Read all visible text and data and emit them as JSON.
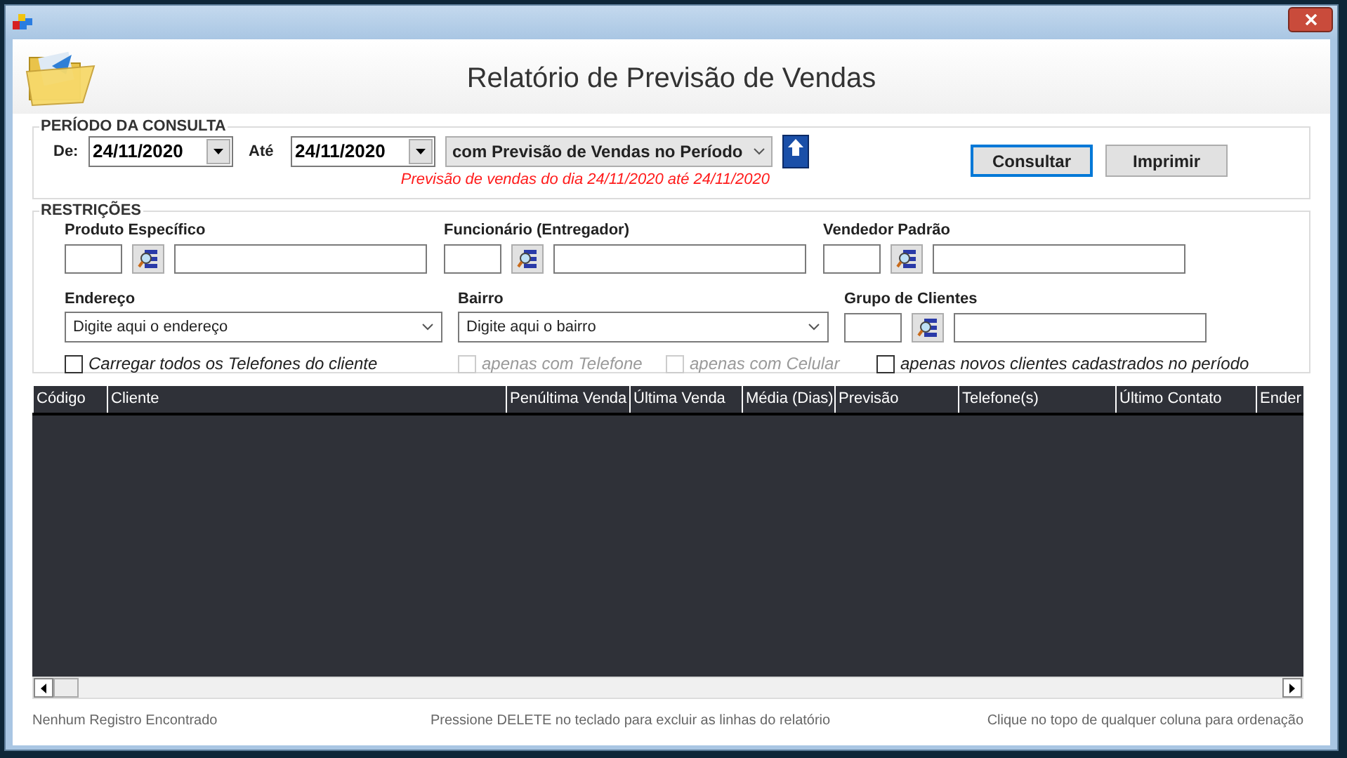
{
  "header": {
    "title": "Relatório de Previsão de Vendas"
  },
  "periodo": {
    "legend": "PERÍODO DA CONSULTA",
    "de_label": "De:",
    "de_value": "24/11/2020",
    "ate_label": "Até",
    "ate_value": "24/11/2020",
    "filter": "com Previsão de Vendas no Período",
    "note": "Previsão de vendas do dia 24/11/2020 até 24/11/2020"
  },
  "buttons": [
    {
      "label": "Consultar",
      "focused": true
    },
    {
      "label": "Imprimir",
      "focused": false
    }
  ],
  "restricoes": {
    "legend": "RESTRIÇÕES",
    "lookups": [
      {
        "label": "Produto Específico"
      },
      {
        "label": "Funcionário (Entregador)"
      },
      {
        "label": "Vendedor Padrão"
      }
    ],
    "combos": [
      {
        "label": "Endereço",
        "placeholder": "Digite aqui o endereço"
      },
      {
        "label": "Bairro",
        "placeholder": "Digite aqui o bairro"
      }
    ],
    "grupo": {
      "label": "Grupo de Clientes"
    },
    "checkboxes": [
      {
        "label": "Carregar todos os Telefones do cliente",
        "checked": false,
        "disabled": false
      },
      {
        "label": "apenas com Telefone",
        "checked": false,
        "disabled": true
      },
      {
        "label": "apenas com Celular",
        "checked": false,
        "disabled": true
      },
      {
        "label": "apenas novos clientes cadastrados no período",
        "checked": false,
        "disabled": false
      }
    ]
  },
  "table": {
    "columns": [
      "Código",
      "Cliente",
      "Penúltima Venda",
      "Última Venda",
      "Média (Dias)",
      "Previsão",
      "Telefone(s)",
      "Último Contato",
      "Ender"
    ]
  },
  "status_bar": {
    "left": "Nenhum Registro Encontrado",
    "center": "Pressione DELETE no teclado para excluir as linhas do relatório",
    "right": "Clique no topo de qualquer coluna para ordenação"
  }
}
